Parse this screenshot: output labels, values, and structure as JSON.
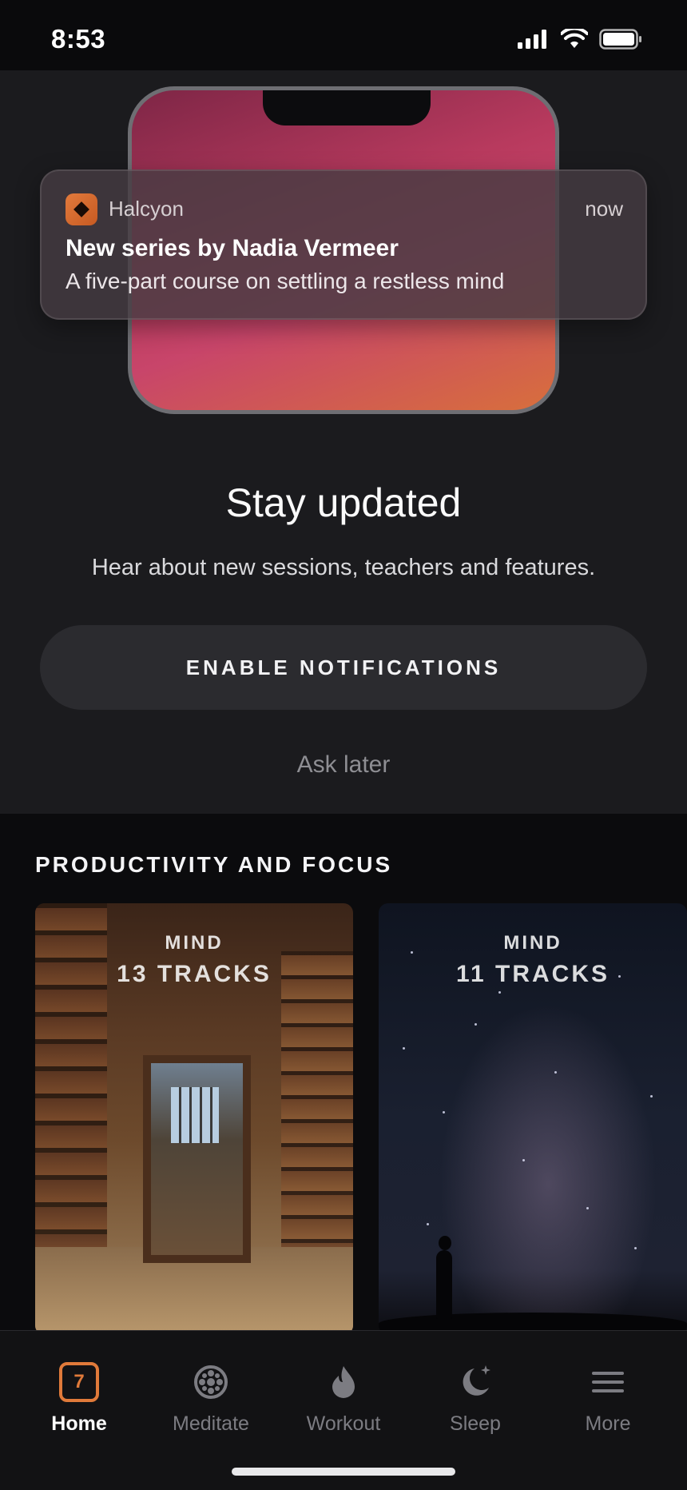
{
  "status_bar": {
    "time": "8:53"
  },
  "notification": {
    "app_name": "Halcyon",
    "time": "now",
    "title": "New series by Nadia Vermeer",
    "body": "A five-part course on settling a restless mind"
  },
  "promo": {
    "title": "Stay updated",
    "subtitle": "Hear about new sessions, teachers and features.",
    "enable_button": "ENABLE NOTIFICATIONS",
    "ask_later": "Ask later"
  },
  "section": {
    "title": "PRODUCTIVITY AND FOCUS",
    "cards": [
      {
        "kicker": "MIND",
        "count": "13 TRACKS"
      },
      {
        "kicker": "MIND",
        "count": "11 TRACKS"
      }
    ]
  },
  "tabs": [
    {
      "label": "Home",
      "badge": "7",
      "active": true
    },
    {
      "label": "Meditate"
    },
    {
      "label": "Workout"
    },
    {
      "label": "Sleep"
    },
    {
      "label": "More"
    }
  ],
  "colors": {
    "accent": "#e07a3a"
  }
}
